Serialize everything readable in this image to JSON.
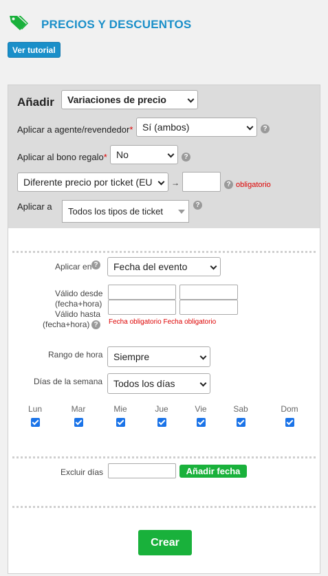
{
  "header": {
    "title": "PRECIOS Y DESCUENTOS",
    "tutorial_button": "Ver tutorial",
    "icon": "price-tag-icon",
    "accent_color": "#1a8fc9"
  },
  "form_top": {
    "add_label": "Añadir",
    "add_select": "Variaciones de precio",
    "agent_label": "Aplicar a agente/revendedor",
    "agent_select": "Sí (ambos)",
    "gift_label": "Aplicar al bono regalo",
    "gift_select": "No",
    "price_select": "Diferente precio por ticket (EU",
    "arrow": "→",
    "price_required": "obligatorio",
    "apply_to_label": "Aplicar a",
    "apply_to_select": "Todos los tipos de ticket",
    "required_mark": "*",
    "help_mark": "?"
  },
  "dates": {
    "apply_on_label": "Aplicar en",
    "apply_on_select": "Fecha del evento",
    "valid_from_label_1": "Válido desde",
    "valid_from_label_2": "(fecha+hora)",
    "valid_to_label_1": "Válido hasta",
    "valid_to_label_2": "(fecha+hora)",
    "required_note": "Fecha obligatorio Fecha obligatorio",
    "time_range_label": "Rango de hora",
    "time_range_select": "Siempre",
    "weekdays_label": "Días de la semana",
    "weekdays_select": "Todos los días",
    "days": [
      "Lun",
      "Mar",
      "Mie",
      "Jue",
      "Vie",
      "Sab",
      "Dom"
    ],
    "days_checked": [
      true,
      true,
      true,
      true,
      true,
      true,
      true
    ]
  },
  "exclude": {
    "label": "Excluir días",
    "add_button": "Añadir fecha"
  },
  "submit": {
    "label": "Crear",
    "color": "#19b13b"
  }
}
